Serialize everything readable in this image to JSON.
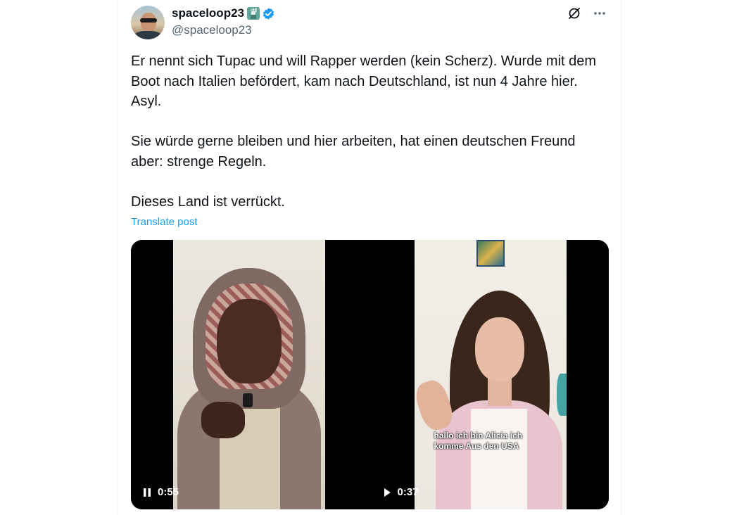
{
  "post": {
    "author": {
      "display_name": "spaceloop23",
      "handle": "@spaceloop23",
      "badges": [
        "statue-of-liberty-emoji",
        "verified-icon"
      ]
    },
    "paragraphs": [
      "Er nennt sich Tupac und will Rapper werden (kein Scherz). Wurde mit dem Boot nach Italien befördert, kam nach Deutschland, ist nun 4 Jahre hier. Asyl.",
      "Sie würde gerne bleiben und hier arbeiten, hat einen deutschen Freund aber: strenge Regeln.",
      "Dieses Land ist verrückt."
    ],
    "translate_label": "Translate post"
  },
  "media": {
    "videos": [
      {
        "state": "playing",
        "control_icon": "pause-icon",
        "time": "0:55",
        "caption": ""
      },
      {
        "state": "paused",
        "control_icon": "play-icon",
        "time": "0:37",
        "caption": "hallo ich bin Alicia ich komme Aus den USA"
      }
    ]
  },
  "colors": {
    "link": "#1d9bf0",
    "verified": "#1d9bf0",
    "text": "#0f1419",
    "secondary": "#536471"
  },
  "top_actions": [
    "grok-icon",
    "more-icon"
  ]
}
